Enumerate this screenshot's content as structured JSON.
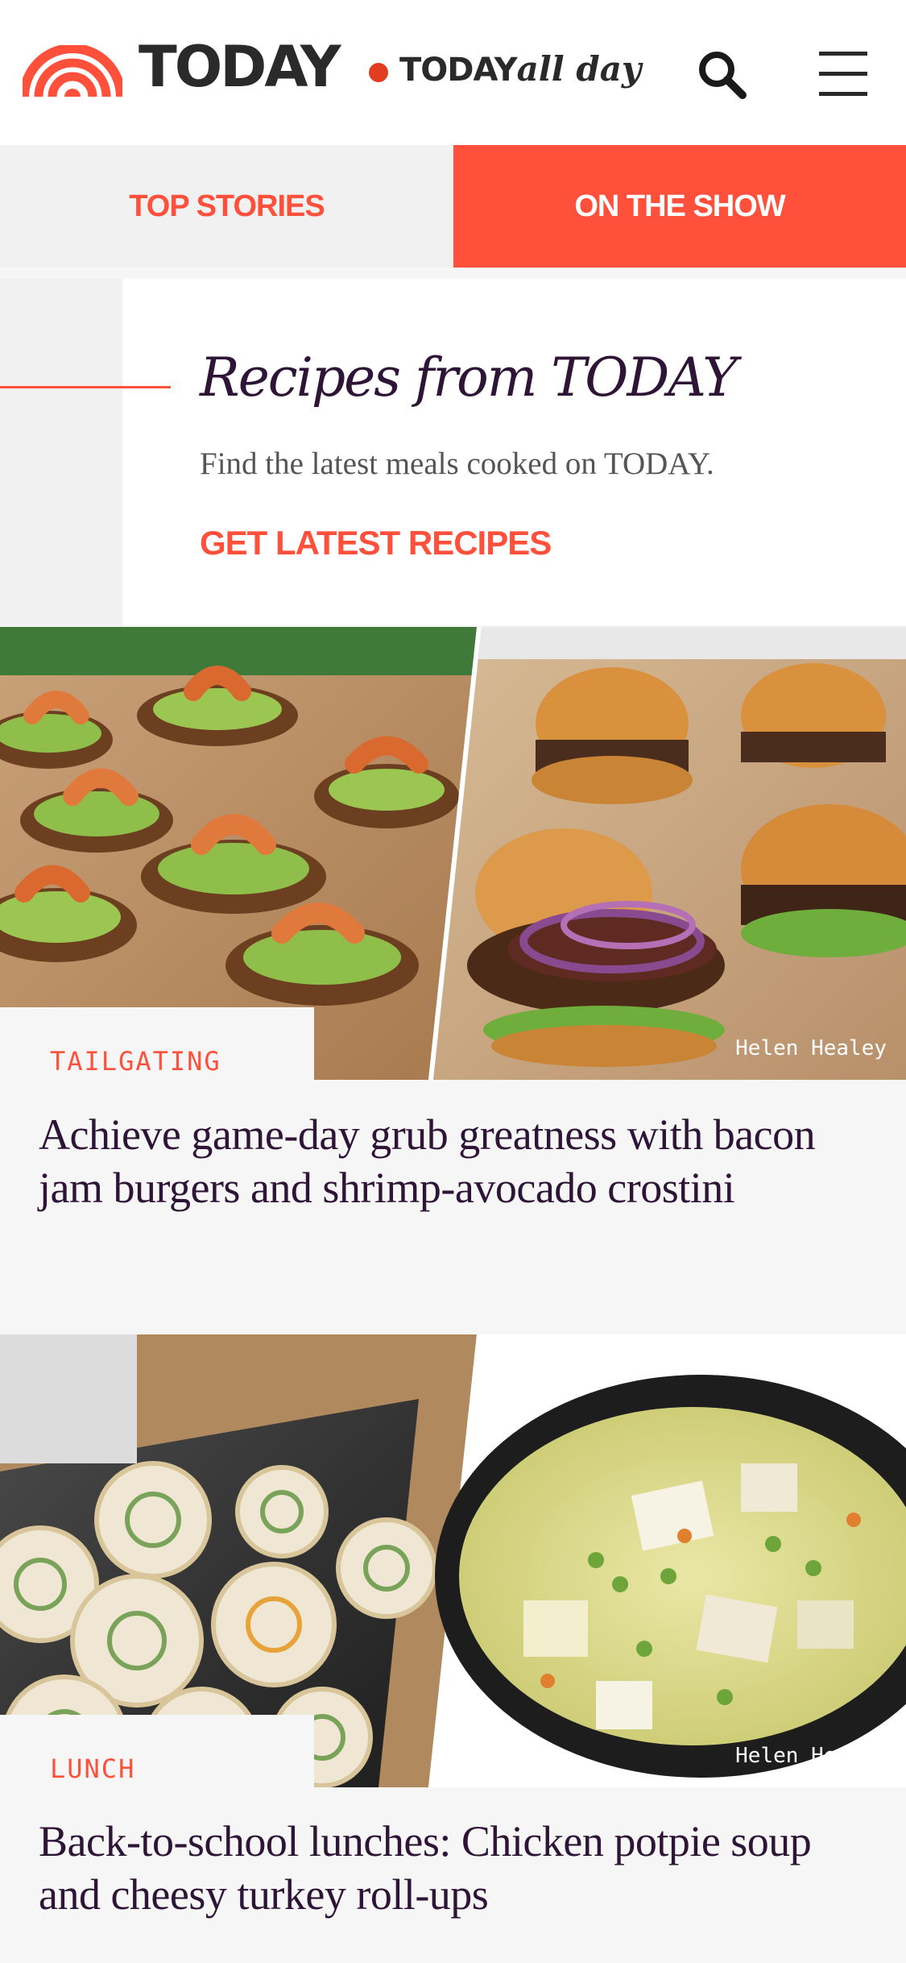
{
  "header": {
    "logo_text": "TODAY",
    "allday_today": "TODAY",
    "allday_italic": "all day",
    "brand_colors": {
      "orange": "#ff503c",
      "red_dot": "#e23d1f",
      "dark": "#2a2a2a"
    },
    "icons": [
      "today-rainbow-logo",
      "search-icon",
      "hamburger-menu-icon"
    ]
  },
  "tabs": [
    {
      "label": "TOP STORIES",
      "active": false
    },
    {
      "label": "ON THE SHOW",
      "active": true
    }
  ],
  "promo": {
    "title": "Recipes from TODAY",
    "subtitle": "Find the latest meals cooked on TODAY.",
    "cta": "GET LATEST RECIPES"
  },
  "stories": [
    {
      "tag": "TAILGATING",
      "headline": "Achieve game-day grub greatness with bacon jam burgers and shrimp-avocado crostini",
      "credit": "Helen Healey",
      "image_left": "shrimp-avocado-crostini",
      "image_right": "bacon-jam-burgers"
    },
    {
      "tag": "LUNCH",
      "headline": "Back-to-school lunches: Chicken potpie soup and cheesy turkey roll-ups",
      "credit": "Helen Healey",
      "image_left": "turkey-roll-ups",
      "image_right": "chicken-potpie-soup"
    }
  ]
}
